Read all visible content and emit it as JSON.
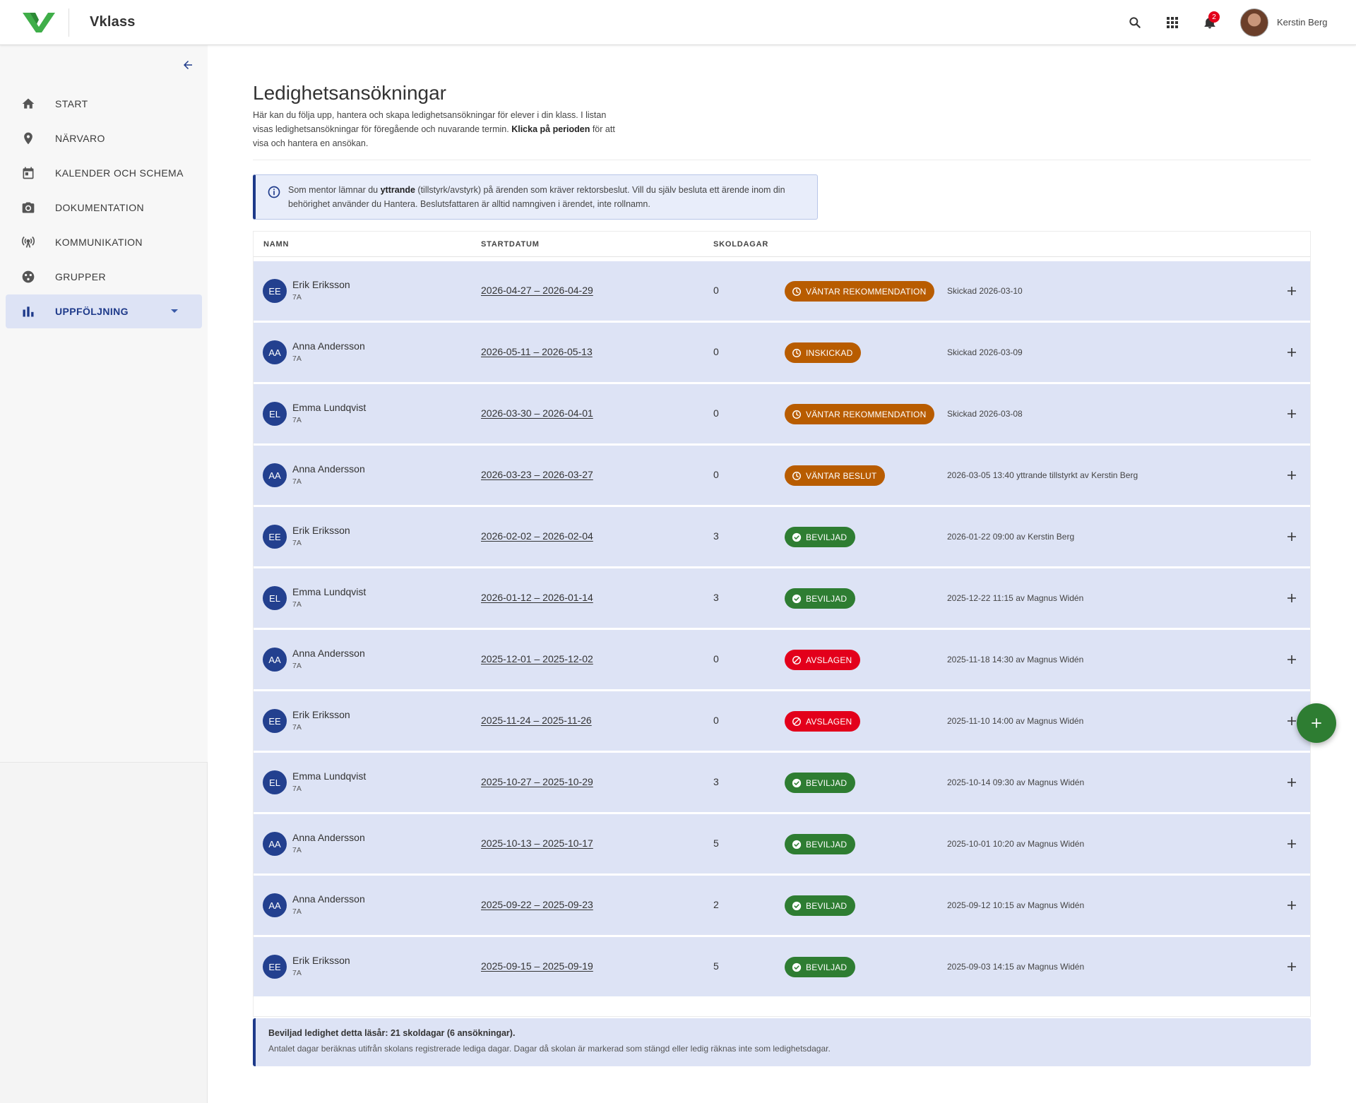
{
  "app": {
    "brand": "Vklass",
    "user_name": "Kerstin Berg",
    "notification_count": "2"
  },
  "sidebar": {
    "items": [
      {
        "label": "START",
        "icon": "home-icon"
      },
      {
        "label": "NÄRVARO",
        "icon": "location-pin-icon"
      },
      {
        "label": "KALENDER OCH SCHEMA",
        "icon": "calendar-icon"
      },
      {
        "label": "DOKUMENTATION",
        "icon": "camera-icon"
      },
      {
        "label": "KOMMUNIKATION",
        "icon": "broadcast-icon"
      },
      {
        "label": "GRUPPER",
        "icon": "groups-icon"
      },
      {
        "label": "UPPFÖLJNING",
        "icon": "bar-chart-icon"
      }
    ]
  },
  "page": {
    "title": "Ledighetsansökningar",
    "intro_1": "Här kan du följa upp, hantera och skapa ledighetsansökningar för elever i din klass. I listan visas ledighetsansökningar för föregående och nuvarande termin. ",
    "intro_bold": "Klicka på perioden",
    "intro_2": " för att visa och hantera en ansökan."
  },
  "info": {
    "text_1": "Som mentor lämnar du ",
    "bold": "yttrande",
    "text_2": " (tillstyrk/avstyrk) på ärenden som kräver rektorsbeslut. Vill du själv besluta ett ärende inom din behörighet använder du Hantera. Beslutsfattaren är alltid namngiven i ärendet, inte rollnamn."
  },
  "table": {
    "headers": {
      "name": "NAMN",
      "start": "STARTDATUM",
      "days": "SKOLDAGAR"
    },
    "rows": [
      {
        "initials": "EE",
        "name": "Erik Eriksson",
        "class": "7A",
        "dates": "2026-04-27 – 2026-04-29",
        "days": "0",
        "status": "VÄNTAR REKOMMENDATION",
        "status_type": "pending",
        "note": "Skickad 2026-03-10"
      },
      {
        "initials": "AA",
        "name": "Anna Andersson",
        "class": "7A",
        "dates": "2026-05-11 – 2026-05-13",
        "days": "0",
        "status": "INSKICKAD",
        "status_type": "pending",
        "note": "Skickad 2026-03-09"
      },
      {
        "initials": "EL",
        "name": "Emma Lundqvist",
        "class": "7A",
        "dates": "2026-03-30 – 2026-04-01",
        "days": "0",
        "status": "VÄNTAR REKOMMENDATION",
        "status_type": "pending",
        "note": "Skickad 2026-03-08"
      },
      {
        "initials": "AA",
        "name": "Anna Andersson",
        "class": "7A",
        "dates": "2026-03-23 – 2026-03-27",
        "days": "0",
        "status": "VÄNTAR BESLUT",
        "status_type": "pending",
        "note": "2026-03-05 13:40 yttrande tillstyrkt av Kerstin Berg"
      },
      {
        "initials": "EE",
        "name": "Erik Eriksson",
        "class": "7A",
        "dates": "2026-02-02 – 2026-02-04",
        "days": "3",
        "status": "BEVILJAD",
        "status_type": "approved",
        "note": "2026-01-22 09:00 av Kerstin Berg"
      },
      {
        "initials": "EL",
        "name": "Emma Lundqvist",
        "class": "7A",
        "dates": "2026-01-12 – 2026-01-14",
        "days": "3",
        "status": "BEVILJAD",
        "status_type": "approved",
        "note": "2025-12-22 11:15 av Magnus Widén"
      },
      {
        "initials": "AA",
        "name": "Anna Andersson",
        "class": "7A",
        "dates": "2025-12-01 – 2025-12-02",
        "days": "0",
        "status": "AVSLAGEN",
        "status_type": "rejected",
        "note": "2025-11-18 14:30 av Magnus Widén"
      },
      {
        "initials": "EE",
        "name": "Erik Eriksson",
        "class": "7A",
        "dates": "2025-11-24 – 2025-11-26",
        "days": "0",
        "status": "AVSLAGEN",
        "status_type": "rejected",
        "note": "2025-11-10 14:00 av Magnus Widén"
      },
      {
        "initials": "EL",
        "name": "Emma Lundqvist",
        "class": "7A",
        "dates": "2025-10-27 – 2025-10-29",
        "days": "3",
        "status": "BEVILJAD",
        "status_type": "approved",
        "note": "2025-10-14 09:30 av Magnus Widén"
      },
      {
        "initials": "AA",
        "name": "Anna Andersson",
        "class": "7A",
        "dates": "2025-10-13 – 2025-10-17",
        "days": "5",
        "status": "BEVILJAD",
        "status_type": "approved",
        "note": "2025-10-01 10:20 av Magnus Widén"
      },
      {
        "initials": "AA",
        "name": "Anna Andersson",
        "class": "7A",
        "dates": "2025-09-22 – 2025-09-23",
        "days": "2",
        "status": "BEVILJAD",
        "status_type": "approved",
        "note": "2025-09-12 10:15 av Magnus Widén"
      },
      {
        "initials": "EE",
        "name": "Erik Eriksson",
        "class": "7A",
        "dates": "2025-09-15 – 2025-09-19",
        "days": "5",
        "status": "BEVILJAD",
        "status_type": "approved",
        "note": "2025-09-03 14:15 av Magnus Widén"
      }
    ]
  },
  "summary": {
    "title": "Beviljad ledighet detta läsår: 21 skoldagar (6 ansökningar).",
    "text": "Antalet dagar beräknas utifrån skolans registrerade lediga dagar. Dagar då skolan är markerad som stängd eller ledig räknas inte som ledighetsdagar."
  },
  "colors": {
    "pending": "#b85c00",
    "approved": "#2e7d32",
    "rejected": "#e3001b",
    "accent": "#1e3a8a",
    "row_bg": "#dde3f5"
  }
}
